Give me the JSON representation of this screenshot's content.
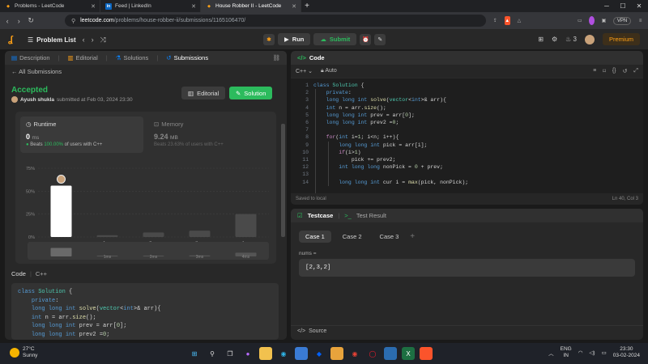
{
  "browser": {
    "tabs": [
      {
        "title": "Problems - LeetCode",
        "icon": "leetcode-icon",
        "color": "#ffa116",
        "active": false
      },
      {
        "title": "Feed | LinkedIn",
        "icon": "linkedin-icon",
        "color": "#0a66c2",
        "active": false
      },
      {
        "title": "House Robber II - LeetCode",
        "icon": "leetcode-icon",
        "color": "#ffa116",
        "active": true
      }
    ],
    "new_tab": "+",
    "url_host": "leetcode.com",
    "url_path": "/problems/house-robber-ii/submissions/1165106470/",
    "vpn": "VPN"
  },
  "header": {
    "problem_list": "Problem List",
    "run": "Run",
    "submit": "Submit",
    "streak": "3",
    "premium": "Premium"
  },
  "left": {
    "tabs": [
      "Description",
      "Editorial",
      "Solutions",
      "Submissions"
    ],
    "all_submissions": "All Submissions",
    "status": "Accepted",
    "author": "Ayush shukla",
    "submitted": "submitted at Feb 03, 2024 23:30",
    "editorial_btn": "Editorial",
    "solution_btn": "Solution",
    "runtime": {
      "label": "Runtime",
      "value": "0",
      "unit": "ms",
      "beats_prefix": "Beats",
      "beats_pct": "100.00%",
      "beats_suffix": "of users with C++"
    },
    "memory": {
      "label": "Memory",
      "value": "9.24",
      "unit": "MB",
      "beats_text": "Beats 23.63% of users with C++"
    },
    "code_label": "Code",
    "code_lang": "C++",
    "code_lines": [
      "class Solution {",
      "    private:",
      "    long long int solve(vector<int>& arr){",
      "    int n = arr.size();",
      "    long long int prev = arr[0];",
      "    long long int prev2 =0;"
    ]
  },
  "chart_data": {
    "type": "bar",
    "y_ticks": [
      "75%",
      "50%",
      "25%",
      "0%"
    ],
    "ylim": [
      0,
      75
    ],
    "categories": [
      "0ms",
      "1ms",
      "2ms",
      "3ms",
      "4ms"
    ],
    "x_labels": [
      "",
      "1ms",
      "2ms",
      "3ms",
      "4ms"
    ],
    "values": [
      56,
      2,
      5,
      7,
      25
    ],
    "highlight_index": 0,
    "mini_labels": [
      "1ms",
      "2ms",
      "3ms",
      "4ms"
    ],
    "highlight_color": "#ffffff",
    "bar_color": "#4a4a4a"
  },
  "code_panel": {
    "title": "Code",
    "lang": "C++",
    "mode": "Auto",
    "line_numbers": [
      "1",
      "2",
      "3",
      "4",
      "5",
      "6",
      "7",
      "8",
      "9",
      "10",
      "11",
      "12",
      "13",
      "14"
    ],
    "saved": "Saved to local",
    "cursor": "Ln 40, Col 3"
  },
  "testcase": {
    "tab": "Testcase",
    "result_tab": "Test Result",
    "cases": [
      "Case 1",
      "Case 2",
      "Case 3"
    ],
    "add": "+",
    "input_label": "nums =",
    "input_value": "[2,3,2]",
    "source": "Source"
  },
  "taskbar": {
    "temp": "27°C",
    "weather": "Sunny",
    "lang": "ENG",
    "region": "IN",
    "time": "23:30",
    "date": "03-02-2024"
  }
}
